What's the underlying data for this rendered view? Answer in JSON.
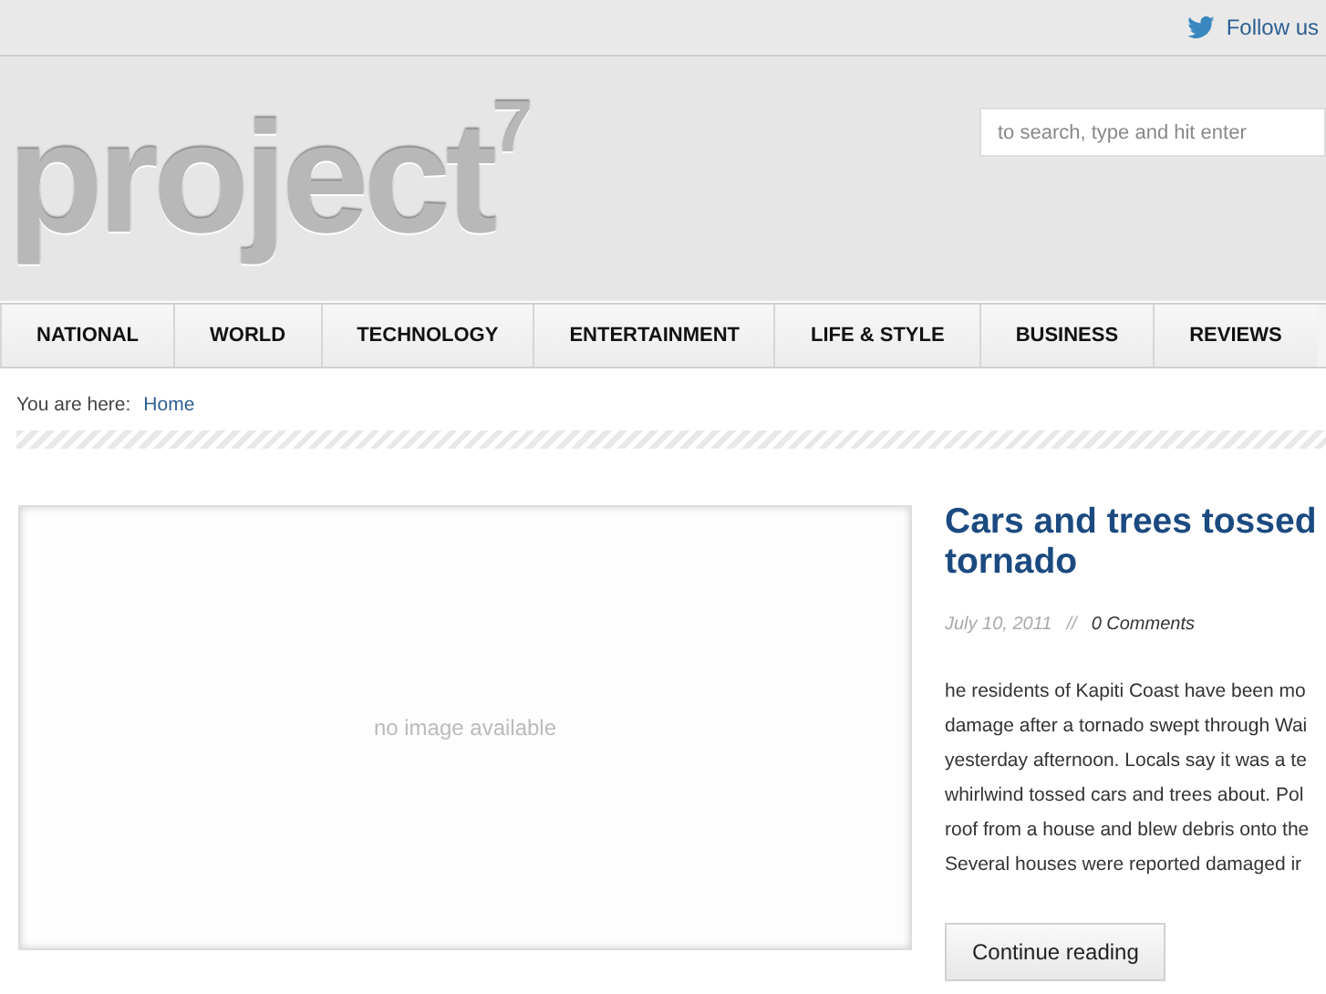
{
  "top_bar": {
    "follow_link": "Follow us"
  },
  "header": {
    "logo": "project$^{7}$",
    "search": {
      "placeholder": "to search, type and hit enter"
    }
  },
  "nav": [
    {
      "label": "NATIONAL"
    },
    {
      "label": "WORLD"
    },
    {
      "label": "TECHNOLOGY"
    },
    {
      "label": "ENTERTAINMENT"
    },
    {
      "label": "LIFE & STYLE"
    },
    {
      "label": "BUSINESS"
    },
    {
      "label": "REVIEWS"
    }
  ],
  "breadcrumb": {
    "label": "You are here:",
    "link": "Home"
  },
  "post": {
    "image_text": "no image available",
    "title_lines": [
      "Cars and trees tossed",
      "tornado"
    ],
    "date": "July 10, 2011",
    "separator": "//",
    "comments": "0 Comments",
    "excerpt_lines": [
      "he residents of Kapiti Coast have been mo",
      "damage after a tornado swept through Wai",
      "yesterday afternoon. Locals say it was a te",
      "whirlwind tossed cars and trees about. Pol",
      "roof from a house and blew debris onto the",
      "Several houses were reported damaged ir"
    ],
    "button": "Continue reading"
  }
}
